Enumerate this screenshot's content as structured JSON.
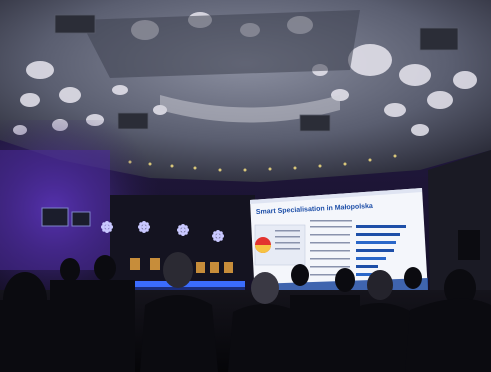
{
  "scene": {
    "kind": "conference-hall-photo",
    "lighting": "dim, purple uplights",
    "colors": {
      "ceiling": "#6f7382",
      "wall_purple": "#4b2a9a",
      "screen_bg": "#f4f6fb",
      "screen_blue": "#1e4fa8",
      "stage_led": "#3b6cff",
      "audience": "#0b0b10"
    }
  },
  "screen": {
    "title": "Smart Specialisation in Małopolska"
  }
}
